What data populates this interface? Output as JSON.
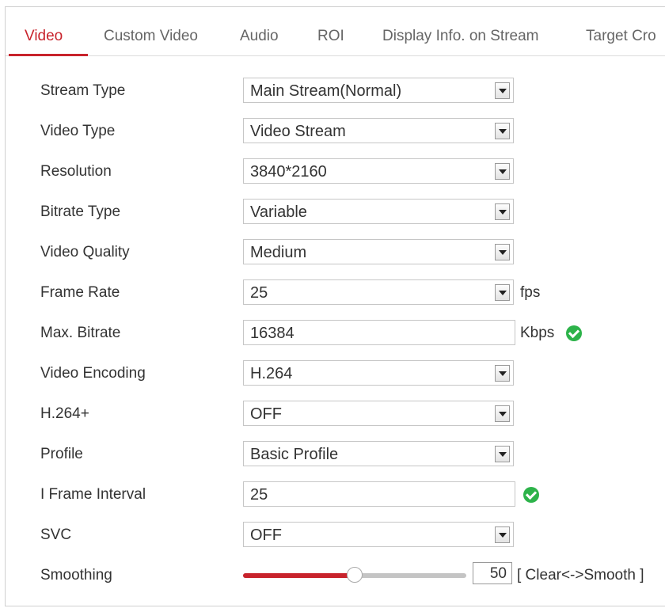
{
  "tabs": [
    {
      "label": "Video",
      "active": true
    },
    {
      "label": "Custom Video"
    },
    {
      "label": "Audio"
    },
    {
      "label": "ROI"
    },
    {
      "label": "Display Info. on Stream"
    },
    {
      "label": "Target Cro"
    }
  ],
  "fields": {
    "stream_type": {
      "label": "Stream Type",
      "value": "Main Stream(Normal)"
    },
    "video_type": {
      "label": "Video Type",
      "value": "Video Stream"
    },
    "resolution": {
      "label": "Resolution",
      "value": "3840*2160"
    },
    "bitrate_type": {
      "label": "Bitrate Type",
      "value": "Variable"
    },
    "video_quality": {
      "label": "Video Quality",
      "value": "Medium"
    },
    "frame_rate": {
      "label": "Frame Rate",
      "value": "25",
      "unit": "fps"
    },
    "max_bitrate": {
      "label": "Max. Bitrate",
      "value": "16384",
      "unit": "Kbps"
    },
    "video_encoding": {
      "label": "Video Encoding",
      "value": "H.264"
    },
    "h264_plus": {
      "label": "H.264+",
      "value": "OFF"
    },
    "profile": {
      "label": "Profile",
      "value": "Basic Profile"
    },
    "i_frame_interval": {
      "label": "I Frame Interval",
      "value": "25"
    },
    "svc": {
      "label": "SVC",
      "value": "OFF"
    },
    "smoothing": {
      "label": "Smoothing",
      "value": "50",
      "hint": "[ Clear<->Smooth ]",
      "level_percent": 50
    }
  },
  "colors": {
    "accent": "#c8232c",
    "valid": "#2db34a"
  },
  "icons": {
    "valid": "check-circle-icon",
    "dropdown": "chevron-down-icon"
  }
}
